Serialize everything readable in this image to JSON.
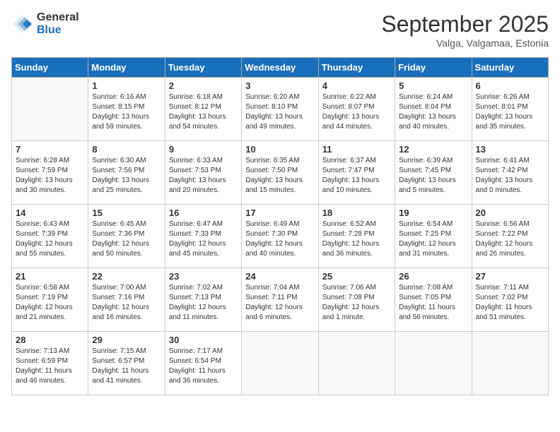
{
  "header": {
    "logo_general": "General",
    "logo_blue": "Blue",
    "month_title": "September 2025",
    "location": "Valga, Valgamaa, Estonia"
  },
  "weekdays": [
    "Sunday",
    "Monday",
    "Tuesday",
    "Wednesday",
    "Thursday",
    "Friday",
    "Saturday"
  ],
  "weeks": [
    [
      {
        "day": "",
        "info": ""
      },
      {
        "day": "1",
        "info": "Sunrise: 6:16 AM\nSunset: 8:15 PM\nDaylight: 13 hours\nand 59 minutes."
      },
      {
        "day": "2",
        "info": "Sunrise: 6:18 AM\nSunset: 8:12 PM\nDaylight: 13 hours\nand 54 minutes."
      },
      {
        "day": "3",
        "info": "Sunrise: 6:20 AM\nSunset: 8:10 PM\nDaylight: 13 hours\nand 49 minutes."
      },
      {
        "day": "4",
        "info": "Sunrise: 6:22 AM\nSunset: 8:07 PM\nDaylight: 13 hours\nand 44 minutes."
      },
      {
        "day": "5",
        "info": "Sunrise: 6:24 AM\nSunset: 8:04 PM\nDaylight: 13 hours\nand 40 minutes."
      },
      {
        "day": "6",
        "info": "Sunrise: 6:26 AM\nSunset: 8:01 PM\nDaylight: 13 hours\nand 35 minutes."
      }
    ],
    [
      {
        "day": "7",
        "info": "Sunrise: 6:28 AM\nSunset: 7:59 PM\nDaylight: 13 hours\nand 30 minutes."
      },
      {
        "day": "8",
        "info": "Sunrise: 6:30 AM\nSunset: 7:56 PM\nDaylight: 13 hours\nand 25 minutes."
      },
      {
        "day": "9",
        "info": "Sunrise: 6:33 AM\nSunset: 7:53 PM\nDaylight: 13 hours\nand 20 minutes."
      },
      {
        "day": "10",
        "info": "Sunrise: 6:35 AM\nSunset: 7:50 PM\nDaylight: 13 hours\nand 15 minutes."
      },
      {
        "day": "11",
        "info": "Sunrise: 6:37 AM\nSunset: 7:47 PM\nDaylight: 13 hours\nand 10 minutes."
      },
      {
        "day": "12",
        "info": "Sunrise: 6:39 AM\nSunset: 7:45 PM\nDaylight: 13 hours\nand 5 minutes."
      },
      {
        "day": "13",
        "info": "Sunrise: 6:41 AM\nSunset: 7:42 PM\nDaylight: 13 hours\nand 0 minutes."
      }
    ],
    [
      {
        "day": "14",
        "info": "Sunrise: 6:43 AM\nSunset: 7:39 PM\nDaylight: 12 hours\nand 55 minutes."
      },
      {
        "day": "15",
        "info": "Sunrise: 6:45 AM\nSunset: 7:36 PM\nDaylight: 12 hours\nand 50 minutes."
      },
      {
        "day": "16",
        "info": "Sunrise: 6:47 AM\nSunset: 7:33 PM\nDaylight: 12 hours\nand 45 minutes."
      },
      {
        "day": "17",
        "info": "Sunrise: 6:49 AM\nSunset: 7:30 PM\nDaylight: 12 hours\nand 40 minutes."
      },
      {
        "day": "18",
        "info": "Sunrise: 6:52 AM\nSunset: 7:28 PM\nDaylight: 12 hours\nand 36 minutes."
      },
      {
        "day": "19",
        "info": "Sunrise: 6:54 AM\nSunset: 7:25 PM\nDaylight: 12 hours\nand 31 minutes."
      },
      {
        "day": "20",
        "info": "Sunrise: 6:56 AM\nSunset: 7:22 PM\nDaylight: 12 hours\nand 26 minutes."
      }
    ],
    [
      {
        "day": "21",
        "info": "Sunrise: 6:58 AM\nSunset: 7:19 PM\nDaylight: 12 hours\nand 21 minutes."
      },
      {
        "day": "22",
        "info": "Sunrise: 7:00 AM\nSunset: 7:16 PM\nDaylight: 12 hours\nand 16 minutes."
      },
      {
        "day": "23",
        "info": "Sunrise: 7:02 AM\nSunset: 7:13 PM\nDaylight: 12 hours\nand 11 minutes."
      },
      {
        "day": "24",
        "info": "Sunrise: 7:04 AM\nSunset: 7:11 PM\nDaylight: 12 hours\nand 6 minutes."
      },
      {
        "day": "25",
        "info": "Sunrise: 7:06 AM\nSunset: 7:08 PM\nDaylight: 12 hours\nand 1 minute."
      },
      {
        "day": "26",
        "info": "Sunrise: 7:08 AM\nSunset: 7:05 PM\nDaylight: 11 hours\nand 56 minutes."
      },
      {
        "day": "27",
        "info": "Sunrise: 7:11 AM\nSunset: 7:02 PM\nDaylight: 11 hours\nand 51 minutes."
      }
    ],
    [
      {
        "day": "28",
        "info": "Sunrise: 7:13 AM\nSunset: 6:59 PM\nDaylight: 11 hours\nand 46 minutes."
      },
      {
        "day": "29",
        "info": "Sunrise: 7:15 AM\nSunset: 6:57 PM\nDaylight: 11 hours\nand 41 minutes."
      },
      {
        "day": "30",
        "info": "Sunrise: 7:17 AM\nSunset: 6:54 PM\nDaylight: 11 hours\nand 36 minutes."
      },
      {
        "day": "",
        "info": ""
      },
      {
        "day": "",
        "info": ""
      },
      {
        "day": "",
        "info": ""
      },
      {
        "day": "",
        "info": ""
      }
    ]
  ]
}
